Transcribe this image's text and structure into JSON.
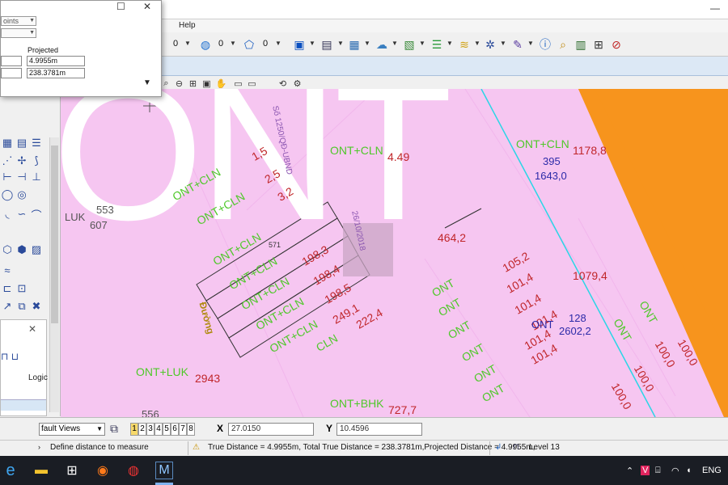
{
  "menubar": {
    "help_label": "Help"
  },
  "toolbar": {
    "level_count_a": "0",
    "level_count_b": "0",
    "level_count_c": "0"
  },
  "dialog": {
    "method_value": "oints",
    "projected_header": "Projected",
    "projected_distance": "4.9955m",
    "projected_total": "238.3781m"
  },
  "leftpanel": {
    "logic_label": "Logic"
  },
  "map": {
    "big_label": "ONT",
    "labels_green": [
      "ONT+CLN",
      "ONT+CLN",
      "ONT+CLN",
      "ONT+CLN",
      "ONT+CLN",
      "ONT+CLN",
      "ONT+CLN",
      "ONT+CLN",
      "ONT+CLN",
      "CLN",
      "ONT+LUK",
      "ONT+BHK",
      "ONT",
      "ONT",
      "ONT",
      "ONT",
      "ONT",
      "ONT",
      "ONT",
      "ONT"
    ],
    "labels_red": [
      "1178,8",
      "4.49",
      "1,5",
      "2,5",
      "3,2",
      "198,3",
      "198,4",
      "198,5",
      "249,1",
      "222,4",
      "464,2",
      "105,2",
      "101,4",
      "101,4",
      "101,4",
      "101,4",
      "101,4",
      "1079,4",
      "2943",
      "727,7",
      "100,0",
      "100,0",
      "100,0",
      "100,0"
    ],
    "labels_blue": [
      "395",
      "1643,0",
      "128",
      "2602,2"
    ],
    "label_luk": "LUK",
    "label_553": "553",
    "label_607": "607",
    "label_556": "556",
    "label_ont_blue": "ONT",
    "label_rotated_doc": "Số 1250/QĐ-UBND",
    "label_rotated_date": "26/10/2018",
    "label_road": "Đường",
    "label_571": "571"
  },
  "coordbar": {
    "view_selector": "fault Views",
    "view_numbers": [
      "1",
      "2",
      "3",
      "4",
      "5",
      "6",
      "7",
      "8"
    ],
    "x_label": "X",
    "x_value": "27.0150",
    "y_label": "Y",
    "y_value": "10.4596"
  },
  "statusbar": {
    "prompt": "Define distance to measure",
    "result": "True Distance = 4.9955m, Total True Distance = 238.3781m,Projected Distance = 4.9955m,",
    "level": "Level 13"
  },
  "taskbar": {
    "language": "ENG"
  },
  "colors": {
    "map_pink": "#f6c6f1",
    "zone_orange": "#f7941d",
    "label_green": "#4fc82a",
    "label_red": "#c0262a",
    "label_blue": "#2c2aa8",
    "road_cyan": "#2ad6e6"
  }
}
